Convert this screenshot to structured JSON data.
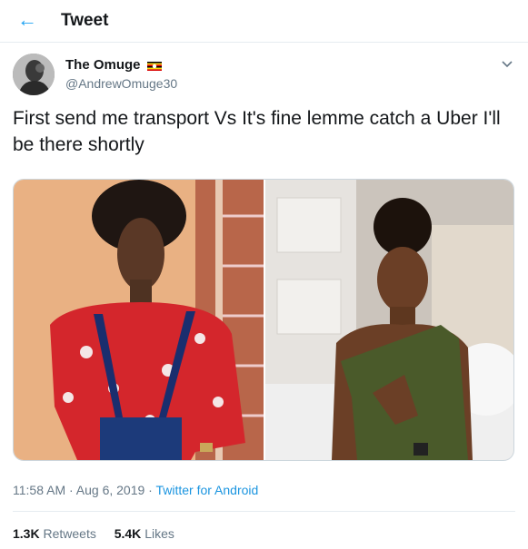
{
  "header": {
    "title": "Tweet",
    "back_icon": "back-arrow-icon"
  },
  "author": {
    "name": "The Omuge",
    "handle": "@AndrewOmuge30",
    "flag_icon": "uganda-flag-icon"
  },
  "tweet": {
    "text": "First send me transport  Vs  It's fine lemme catch a Uber I'll be there shortly",
    "images": [
      "photo-left",
      "photo-right"
    ]
  },
  "meta": {
    "timestamp": "11:58 AM · Aug 6, 2019 · ",
    "source": "Twitter for Android"
  },
  "stats": {
    "retweets_count": "1.3K",
    "retweets_label": "Retweets",
    "likes_count": "5.4K",
    "likes_label": "Likes"
  },
  "colors": {
    "accent": "#1da1f2",
    "text": "#14171a",
    "muted": "#657786",
    "border": "#e6ecf0"
  }
}
